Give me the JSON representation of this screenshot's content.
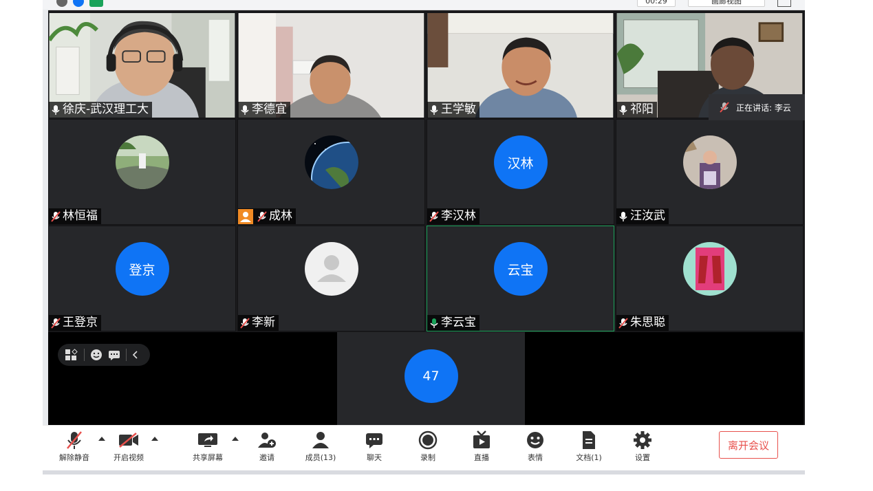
{
  "window": {
    "timer": "00:29",
    "view_mode_label": "画廊视图"
  },
  "speaking": {
    "label": "正在讲话: 李云"
  },
  "participants": [
    {
      "name": "徐庆-武汉理工大",
      "mic": "on",
      "avatar_text": ""
    },
    {
      "name": "李德宜",
      "mic": "on",
      "avatar_text": ""
    },
    {
      "name": "王学敏",
      "mic": "on",
      "avatar_text": ""
    },
    {
      "name": "祁阳",
      "mic": "on",
      "avatar_text": ""
    },
    {
      "name": "林恒福",
      "mic": "muted",
      "avatar_text": ""
    },
    {
      "name": "成林",
      "mic": "muted",
      "avatar_text": ""
    },
    {
      "name": "李汉林",
      "mic": "muted",
      "avatar_text": "汉林"
    },
    {
      "name": "汪汝武",
      "mic": "on",
      "avatar_text": ""
    },
    {
      "name": "王登京",
      "mic": "muted",
      "avatar_text": "登京"
    },
    {
      "name": "李新",
      "mic": "muted",
      "avatar_text": ""
    },
    {
      "name": "李云宝",
      "mic": "speaking",
      "avatar_text": "云宝"
    },
    {
      "name": "朱思聪",
      "mic": "muted",
      "avatar_text": ""
    }
  ],
  "extra_tile": {
    "avatar_text": "47"
  },
  "toolbar": {
    "unmute": "解除静音",
    "start_video": "开启视频",
    "share_screen": "共享屏幕",
    "invite": "邀请",
    "members": "成员(13)",
    "chat": "聊天",
    "record": "录制",
    "live": "直播",
    "reactions": "表情",
    "docs": "文档(1)",
    "settings": "设置",
    "leave": "离开会议"
  },
  "colors": {
    "accent_blue": "#0f74f5",
    "leave_red": "#e8504c",
    "speaking_green": "#1aa35a",
    "muted_red": "#e8504c"
  }
}
